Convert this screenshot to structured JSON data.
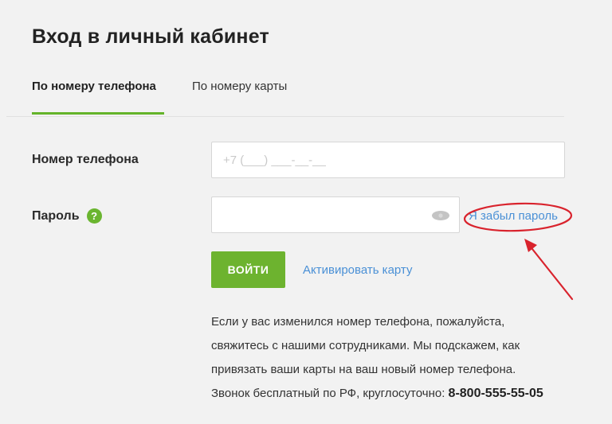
{
  "page": {
    "title": "Вход в личный кабинет"
  },
  "tabs": [
    {
      "label": "По номеру телефона",
      "active": true
    },
    {
      "label": "По номеру карты",
      "active": false
    }
  ],
  "form": {
    "phone_label": "Номер телефона",
    "phone_placeholder": "+7 (___) ___-__-__",
    "phone_value": "",
    "password_label": "Пароль",
    "password_value": "",
    "help_icon": "?",
    "eye_icon": "eye-icon",
    "forgot_label": "Я забыл пароль",
    "login_label": "ВОЙТИ",
    "activate_label": "Активировать карту"
  },
  "info": {
    "lines": [
      "Если у вас изменился номер телефона, пожалуйста,",
      "свяжитесь с нашими сотрудниками. Мы подскажем, как",
      "привязать ваши карты на ваш новый номер телефона."
    ],
    "hotline_text": "Звонок бесплатный по РФ, круглосуточно: ",
    "hotline_phone": "8-800-555-55-05"
  },
  "colors": {
    "accent_green": "#6db32f",
    "link_blue": "#4a90d6",
    "annotation_red": "#d9232d",
    "background": "#f2f2f2"
  }
}
